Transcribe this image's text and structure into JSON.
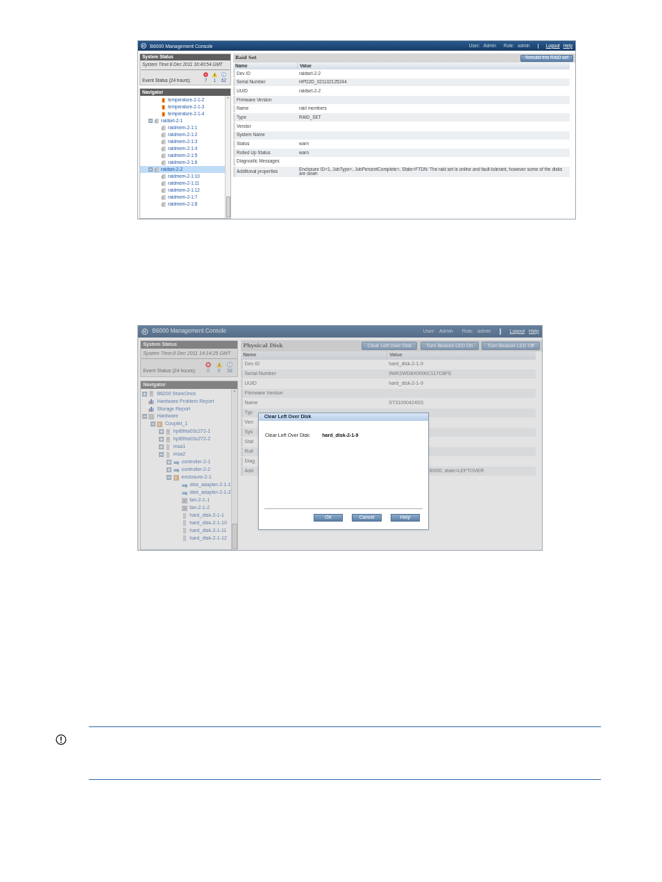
{
  "screens": [
    {
      "header": {
        "title": "B6000 Management Console",
        "user_label": "User:",
        "user": "Admin",
        "role_label": "Role:",
        "role": "admin",
        "links": [
          "Logout",
          "Help"
        ]
      },
      "system_status": {
        "title": "System Status",
        "time": "System Time:8 Dec 2011 16:40:54 GMT",
        "event_label": "Event Status (24 hours):",
        "counts": [
          {
            "kind": "error",
            "value": "7"
          },
          {
            "kind": "warning",
            "value": "1"
          },
          {
            "kind": "info",
            "value": "62"
          }
        ]
      },
      "navigator": {
        "title": "Navigator",
        "tree": [
          {
            "children": [
              {
                "children": [
                  {
                    "kind": "thermometer",
                    "label": "temperature-2-1-2",
                    "selected": false
                  },
                  {
                    "kind": "thermometer",
                    "label": "temperature-2-1-3",
                    "selected": false
                  },
                  {
                    "kind": "thermometer",
                    "label": "temperature-2-1-4",
                    "selected": false
                  }
                ]
              },
              {
                "kind": "disk-stack",
                "label": "raidset-2-1",
                "selected": false,
                "expanded": true,
                "children": [
                  {
                    "kind": "disk-stack",
                    "label": "raidmem-2-1:1",
                    "selected": false
                  },
                  {
                    "kind": "disk-stack",
                    "label": "raidmem-2-1:2",
                    "selected": false
                  },
                  {
                    "kind": "disk-stack",
                    "label": "raidmem-2-1:3",
                    "selected": false
                  },
                  {
                    "kind": "disk-stack",
                    "label": "raidmem-2-1:4",
                    "selected": false
                  },
                  {
                    "kind": "disk-stack",
                    "label": "raidmem-2-1:5",
                    "selected": false
                  },
                  {
                    "kind": "disk-stack",
                    "label": "raidmem-2-1:6",
                    "selected": false
                  }
                ]
              },
              {
                "kind": "disk-stack",
                "label": "raidset-2-2",
                "selected": true,
                "expanded": true,
                "children": [
                  {
                    "kind": "disk-stack",
                    "label": "raidmem-2-1:10",
                    "selected": false
                  },
                  {
                    "kind": "disk-stack",
                    "label": "raidmem-2-1:11",
                    "selected": false
                  },
                  {
                    "kind": "disk-stack",
                    "label": "raidmem-2-1:12",
                    "selected": false
                  },
                  {
                    "kind": "disk-stack",
                    "label": "raidmem-2-1:7",
                    "selected": false
                  },
                  {
                    "kind": "disk-stack",
                    "label": "raidmem-2-1:8",
                    "selected": false
                  }
                ]
              }
            ]
          }
        ]
      },
      "panel": {
        "title": "Raid Set",
        "buttons": [
          "Rebuild this RAID set"
        ],
        "columns": [
          "Name",
          "Value"
        ],
        "rows": [
          {
            "name": "Dev ID",
            "value": "raidset-2-2"
          },
          {
            "name": "Serial Number",
            "value": "HPD2D_021102125244"
          },
          {
            "name": "UUID",
            "value": "raidset-2-2"
          },
          {
            "name": "Firmware Version",
            "value": ""
          },
          {
            "name": "Name",
            "value": "raid members"
          },
          {
            "name": "Type",
            "value": "RAID_SET"
          },
          {
            "name": "Vendor",
            "value": ""
          },
          {
            "name": "System Name",
            "value": ""
          },
          {
            "name": "Status",
            "value": "warn"
          },
          {
            "name": "Rolled Up Status",
            "value": "warn"
          },
          {
            "name": "Diagnostic Messages",
            "value": ""
          },
          {
            "name": "Additional properties",
            "value": "Enclosure ID=1, JobType=, JobPercentComplete=, State=FTDN: The raid set is online and fault-tolerant, however some of the disks are down"
          }
        ]
      }
    },
    {
      "header": {
        "title": "B6000 Management Console",
        "user_label": "User:",
        "user": "Admin",
        "role_label": "Role:",
        "role": "admin",
        "links": [
          "Logout",
          "Help"
        ]
      },
      "system_status": {
        "title": "System Status",
        "time": "System Time:8 Dec 2011 14:14:25 GMT",
        "event_label": "Event Status (24 hours):",
        "counts": [
          {
            "kind": "error",
            "value": "0"
          },
          {
            "kind": "warning",
            "value": "0"
          },
          {
            "kind": "info",
            "value": "38"
          }
        ]
      },
      "navigator": {
        "title": "Navigator",
        "tree": [
          {
            "kind": "server",
            "label": "B6200 StoreOnce",
            "selected": false,
            "expanded": false
          },
          {
            "kind": "report",
            "label": "Hardware Problem Report",
            "selected": false
          },
          {
            "kind": "report",
            "label": "Storage Report",
            "selected": false
          },
          {
            "kind": "hardware",
            "label": "Hardware",
            "selected": false,
            "expanded": true,
            "children": [
              {
                "kind": "box",
                "label": "Couplet_1",
                "selected": false,
                "expanded": true,
                "children": [
                  {
                    "kind": "server",
                    "label": "hp89tra03c272-1",
                    "selected": false,
                    "expanded": false
                  },
                  {
                    "kind": "server",
                    "label": "hp89tra03c272-2",
                    "selected": false,
                    "expanded": false
                  },
                  {
                    "kind": "drive",
                    "label": "msa1",
                    "selected": false,
                    "expanded": false
                  },
                  {
                    "kind": "drive",
                    "label": "msa2",
                    "selected": false,
                    "expanded": true,
                    "children": [
                      {
                        "kind": "card",
                        "label": "controller-2-1",
                        "selected": false,
                        "expanded": false
                      },
                      {
                        "kind": "card",
                        "label": "controller-2-2",
                        "selected": false,
                        "expanded": false
                      },
                      {
                        "kind": "box",
                        "label": "enclosure-2-1",
                        "selected": false,
                        "expanded": true,
                        "children": [
                          {
                            "kind": "card",
                            "label": "disk_adapter-2-1-1",
                            "selected": false
                          },
                          {
                            "kind": "card",
                            "label": "disk_adapter-2-1-2",
                            "selected": false
                          },
                          {
                            "kind": "fan",
                            "label": "fan-2-1-1",
                            "selected": false
                          },
                          {
                            "kind": "fan",
                            "label": "fan-2-1-2",
                            "selected": false
                          },
                          {
                            "kind": "drive",
                            "label": "hard_disk-2-1-1",
                            "selected": false
                          },
                          {
                            "kind": "drive",
                            "label": "hard_disk-2-1-10",
                            "selected": false
                          },
                          {
                            "kind": "drive",
                            "label": "hard_disk-2-1-11",
                            "selected": false
                          },
                          {
                            "kind": "drive",
                            "label": "hard_disk-2-1-12",
                            "selected": false
                          }
                        ]
                      }
                    ]
                  }
                ]
              }
            ]
          }
        ]
      },
      "panel": {
        "title": "Physical Disk",
        "buttons": [
          "Clear Left Over Disk",
          "Turn Beacon LED On",
          "Turn Beacon LED Off"
        ],
        "columns": [
          "Name",
          "Value"
        ],
        "rows": [
          {
            "name": "Dev ID",
            "value": "hard_disk-2-1-9"
          },
          {
            "name": "Serial Number",
            "value": "9WK2WD8X0000C117C8FS"
          },
          {
            "name": "UUID",
            "value": "hard_disk-2-1-9"
          },
          {
            "name": "Firmware Version",
            "value": ""
          },
          {
            "name": "Name",
            "value": "ST31000424SS"
          },
          {
            "name": "Typ",
            "value": "",
            "covered": true
          },
          {
            "name": "Ven",
            "value": "",
            "covered": true
          },
          {
            "name": "Sys",
            "value": "",
            "covered": true
          },
          {
            "name": "Stat",
            "value": "",
            "covered": true
          },
          {
            "name": "Roll",
            "value": "",
            "covered": true
          },
          {
            "name": "Diag",
            "value": "",
            "covered": true
          },
          {
            "name": "Add",
            "value": "00000, state=LEFTOVER",
            "covered": true
          }
        ]
      },
      "dialog": {
        "title": "Clear Left Over Disk",
        "label": "Clear Left Over Disk:",
        "value": "hard_disk-2-1-9",
        "buttons": [
          "OK",
          "Cancel",
          "Help"
        ]
      }
    }
  ],
  "notice": {
    "kind": "important"
  }
}
